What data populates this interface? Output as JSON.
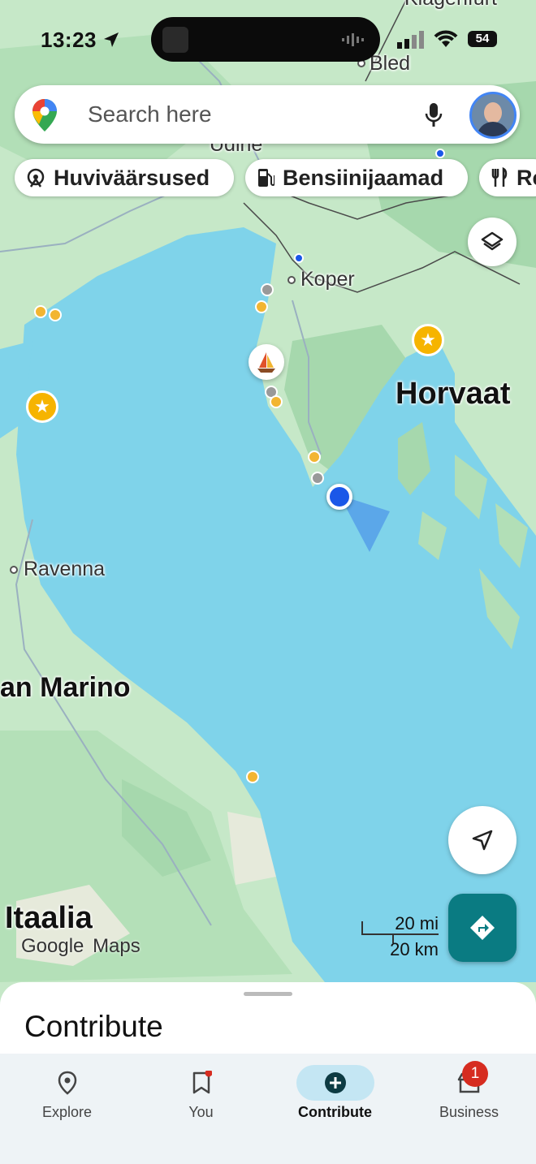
{
  "status_bar": {
    "time": "13:23",
    "battery": "54"
  },
  "search": {
    "placeholder": "Search here"
  },
  "chips": [
    {
      "label": "Huviväärsused",
      "icon": "attraction-icon"
    },
    {
      "label": "Bensiinijaamad",
      "icon": "gas-station-icon"
    },
    {
      "label": "Re",
      "icon": "restaurant-icon"
    }
  ],
  "map": {
    "labels": {
      "klagenfurt": "Klagenfurt",
      "bled": "Bled",
      "udine": "Udine",
      "koper": "Koper",
      "horvaatia": "Horvaat",
      "ravenna": "Ravenna",
      "san_marino": "an Marino",
      "itaalia": "Itaalia"
    },
    "attribution": {
      "google": "Google",
      "maps": "Maps"
    },
    "scale": {
      "miles": "20 mi",
      "km": "20 km"
    }
  },
  "sheet": {
    "title": "Contribute"
  },
  "nav": {
    "items": [
      {
        "label": "Explore"
      },
      {
        "label": "You"
      },
      {
        "label": "Contribute"
      },
      {
        "label": "Business"
      }
    ],
    "business_badge": "1"
  },
  "colors": {
    "water": "#7fd3ea",
    "land": "#c6e8c8",
    "forest": "#a8d9ae",
    "accent": "#0a7b82",
    "location": "#1a57e8"
  }
}
